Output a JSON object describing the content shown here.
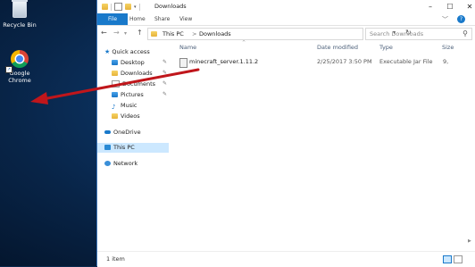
{
  "desktop": {
    "icons": [
      {
        "label": "Recycle Bin",
        "icon": "recycle-bin-icon"
      },
      {
        "label": "Google Chrome",
        "line1": "Google",
        "line2": "Chrome",
        "icon": "chrome-icon"
      }
    ]
  },
  "window": {
    "title": "Downloads",
    "controls": {
      "minimize": "–",
      "maximize": "☐",
      "close": "✕"
    },
    "ribbon_tabs": [
      {
        "label": "File",
        "active": true
      },
      {
        "label": "Home"
      },
      {
        "label": "Share"
      },
      {
        "label": "View"
      }
    ],
    "address": {
      "breadcrumbs": [
        "This PC",
        "Downloads"
      ],
      "separator": ">"
    },
    "search": {
      "placeholder": "Search Downloads"
    },
    "nav_pane": {
      "quick_access": "Quick access",
      "items": [
        {
          "label": "Desktop",
          "pinned": true
        },
        {
          "label": "Downloads",
          "pinned": true
        },
        {
          "label": "Documents",
          "pinned": true
        },
        {
          "label": "Pictures",
          "pinned": true
        },
        {
          "label": "Music"
        },
        {
          "label": "Videos"
        }
      ],
      "onedrive": "OneDrive",
      "this_pc": "This PC",
      "network": "Network"
    },
    "columns": [
      "Name",
      "Date modified",
      "Type",
      "Size"
    ],
    "files": [
      {
        "name": "minecraft_server.1.11.2",
        "date": "2/25/2017 3:50 PM",
        "type": "Executable Jar File",
        "size": "9,"
      }
    ],
    "status": {
      "count": "1 item"
    }
  },
  "colors": {
    "accent": "#1979ca",
    "selection": "#cce8ff",
    "annotation_arrow": "#c0161b"
  }
}
